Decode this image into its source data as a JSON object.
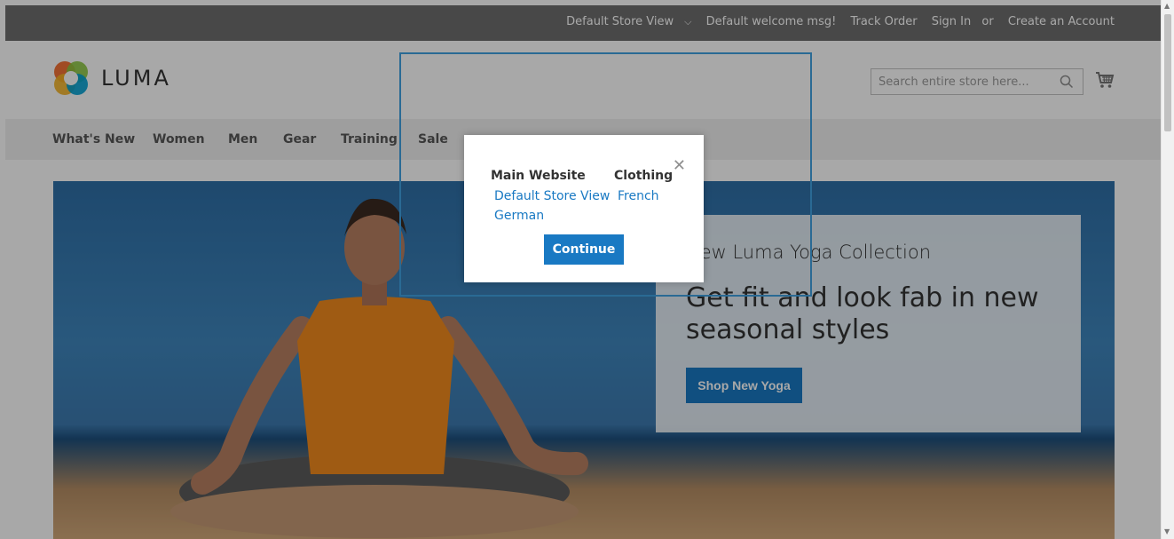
{
  "top_bar": {
    "store_switcher": "Default Store View",
    "welcome": "Default welcome msg!",
    "track_order": "Track Order",
    "sign_in": "Sign In",
    "or": "or",
    "create_account": "Create an Account"
  },
  "header": {
    "logo_text": "LUMA",
    "search_placeholder": "Search entire store here...",
    "search_icon": "search-icon",
    "cart_icon": "cart-icon"
  },
  "nav": {
    "items": [
      "What's New",
      "Women",
      "Men",
      "Gear",
      "Training",
      "Sale"
    ]
  },
  "hero": {
    "subtitle": "New Luma Yoga Collection",
    "title": "Get fit and look fab in new seasonal styles",
    "button": "Shop New Yoga"
  },
  "modal": {
    "col1": {
      "heading": "Main Website",
      "links": [
        "Default Store View",
        "German"
      ]
    },
    "col2": {
      "heading": "Clothing",
      "links": [
        "French"
      ]
    },
    "continue": "Continue",
    "close_icon": "close-icon"
  },
  "colors": {
    "accent": "#1979c3",
    "top_bar": "#6e6e6e",
    "nav": "#f0f0f0"
  }
}
